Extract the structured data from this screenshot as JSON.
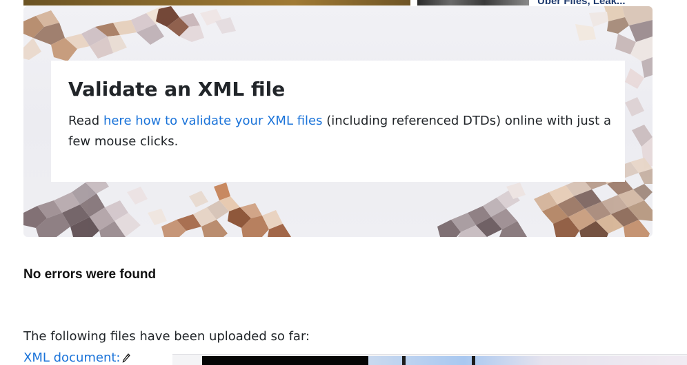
{
  "top": {
    "headline": "Uber Files, Leak..."
  },
  "hero": {
    "title": "Validate an XML file",
    "text_before": "Read ",
    "link_text": "here how to validate your XML files",
    "text_after": " (including referenced DTDs) online with just a few mouse clicks."
  },
  "status": {
    "message": "No errors were found"
  },
  "uploads": {
    "intro": "The following files have been uploaded so far:",
    "files": [
      {
        "label": "XML document:",
        "icon": "pencil-icon"
      }
    ]
  },
  "colors": {
    "link": "#1a73d9",
    "text": "#212529"
  }
}
